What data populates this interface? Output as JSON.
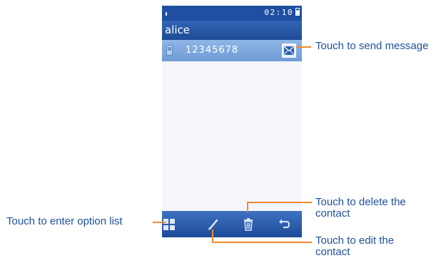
{
  "status_bar": {
    "time": "02:10"
  },
  "contact": {
    "name": "alice",
    "number": "12345678"
  },
  "toolbar": {
    "icons": [
      "grid-icon",
      "pencil-icon",
      "trash-icon",
      "back-arrow-icon"
    ]
  },
  "callouts": {
    "send_message": "Touch to send message",
    "delete_contact_line1": "Touch to delete the",
    "delete_contact_line2": "contact",
    "option_list": "Touch to enter option list",
    "edit_contact_line1": "Touch to edit the",
    "edit_contact_line2": "contact"
  },
  "colors": {
    "accent_blue": "#1f4fa0",
    "callout_line": "#f08a2c",
    "callout_text": "#1f4f9b"
  }
}
